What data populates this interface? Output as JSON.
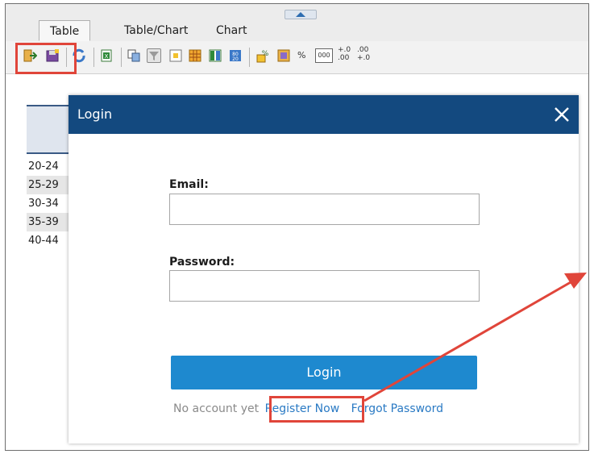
{
  "tabs": [
    {
      "label": "Table"
    },
    {
      "label": "Table/Chart"
    },
    {
      "label": "Chart"
    }
  ],
  "toolbar": {
    "icons": [
      "export-icon",
      "save-icon",
      "refresh-icon",
      "excel-icon",
      "copy-icon",
      "filter-icon",
      "freeze-icon",
      "grid-icon",
      "columns-icon",
      "sort-icon",
      "percent-calc-icon",
      "sum-icon",
      "percent-icon",
      "thousands-icon",
      "increase-decimal-icon",
      "decrease-decimal-icon"
    ],
    "percent_label": "%",
    "thousands_label": "000",
    "increase_decimal_label": "+.0\n.00",
    "decrease_decimal_label": ".00\n+.0"
  },
  "table": {
    "rows": [
      "20-24",
      "25-29",
      "30-34",
      "35-39",
      "40-44"
    ]
  },
  "dialog": {
    "title": "Login",
    "email_label": "Email:",
    "email_value": "",
    "password_label": "Password:",
    "password_value": "",
    "login_button": "Login",
    "no_account": "No account yet",
    "register": "Register Now",
    "forgot": "Forgot Password"
  },
  "colors": {
    "header": "#13497f",
    "button": "#1e89cf",
    "link": "#2a7ac4",
    "annotation": "#e0453a"
  }
}
